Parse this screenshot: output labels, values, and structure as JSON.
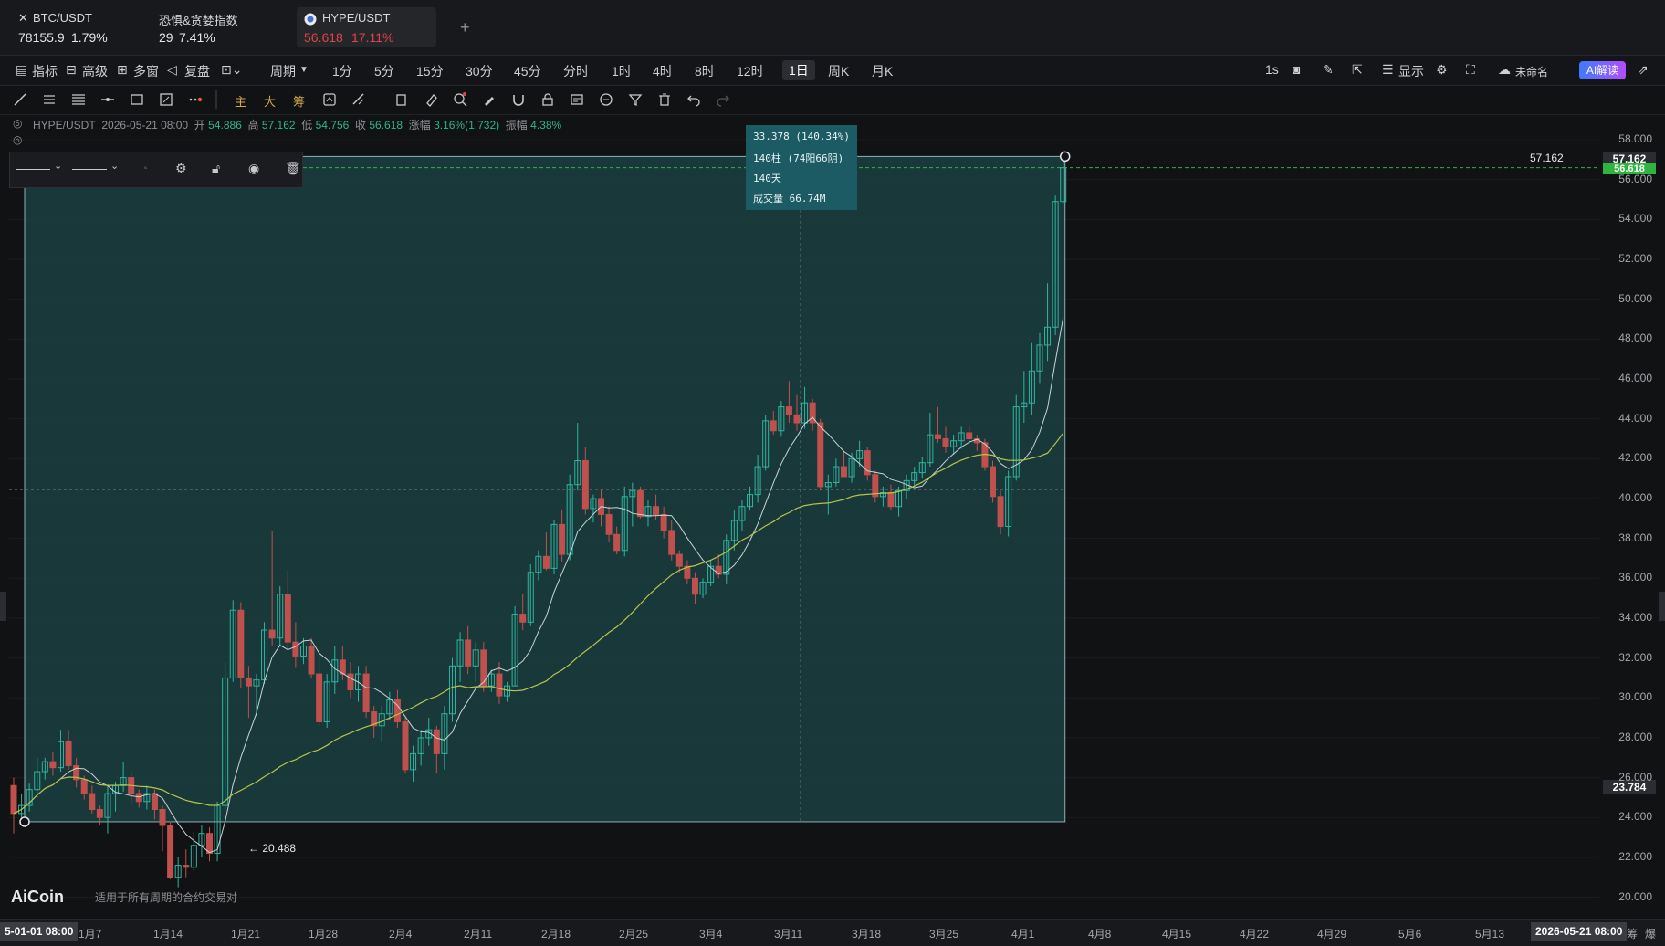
{
  "tabs": [
    {
      "name": "BTC/USDT",
      "price": "78155.9",
      "change": "1.79%",
      "close_icon": "close-icon"
    },
    {
      "name": "恐惧&贪婪指数",
      "price": "29",
      "change": "7.41%"
    },
    {
      "name": "HYPE/USDT",
      "price": "56.618",
      "change": "17.11%",
      "icon": "coin-icon"
    }
  ],
  "add_tab": "+",
  "toolbar": {
    "indicators": "指标",
    "advanced": "高级",
    "multi": "多窗",
    "replay": "复盘",
    "period": "周期",
    "intervals": [
      "1分",
      "5分",
      "15分",
      "30分",
      "45分",
      "分时",
      "1时",
      "4时",
      "8时",
      "12时",
      "1日",
      "周K",
      "月K"
    ],
    "selected_interval": "1日",
    "right": {
      "seconds": "1s",
      "display": "显示",
      "unnamed": "未命名",
      "ai": "AI解读"
    }
  },
  "drawing_tools": {
    "main": "主",
    "big": "大",
    "chip": "筹"
  },
  "info": {
    "symbol": "HYPE/USDT",
    "datetime": "2026-05-21 08:00",
    "open_label": "开",
    "open": "54.886",
    "high_label": "高",
    "high": "57.162",
    "low_label": "低",
    "low": "54.756",
    "close_label": "收",
    "close": "56.618",
    "change_label": "涨幅",
    "change": "3.16%(1.732)",
    "amp_label": "振幅",
    "amp": "4.38%"
  },
  "tooltip": {
    "line1": "33.378 (140.34%)",
    "line2": "140柱 (74阳66阴)",
    "line3": "140天",
    "line4": "成交量 66.74M"
  },
  "price_labels": {
    "high_marker": "57.162",
    "current": "56.618",
    "top_tag": "57.162",
    "low_tag": "23.784",
    "low_marker": "← 20.488"
  },
  "y_axis": [
    "58.000",
    "56.000",
    "54.000",
    "52.000",
    "50.000",
    "48.000",
    "46.000",
    "44.000",
    "42.000",
    "40.000",
    "38.000",
    "36.000",
    "34.000",
    "32.000",
    "30.000",
    "28.000",
    "26.000",
    "24.000",
    "22.000",
    "20.000"
  ],
  "x_axis": {
    "start": "5-01-01 08:00",
    "end": "2026-05-21 08:00",
    "labels": [
      "1月7",
      "1月14",
      "1月21",
      "1月28",
      "2月4",
      "2月11",
      "2月18",
      "2月25",
      "3月4",
      "3月11",
      "3月18",
      "3月25",
      "4月1",
      "4月8",
      "4月15",
      "4月22",
      "4月29",
      "5月6",
      "5月13"
    ],
    "corner": [
      "筹",
      "爆"
    ]
  },
  "logo": "AiCoin",
  "logo_note": "适用于所有周期的合约交易对",
  "colors": {
    "up": "#2eb5a0",
    "down": "#c0504d",
    "ma_fast": "#c9d4d6",
    "ma_slow": "#b8c44a",
    "range_fill": "#1b3f41"
  },
  "chart_data": {
    "type": "candlestick",
    "y_range": [
      19.2,
      58.6
    ],
    "measure_range": {
      "low": 23.784,
      "high": 57.162
    },
    "crosshair_price": 40.45,
    "candles": [
      [
        25.6,
        26.0,
        23.2,
        24.2
      ],
      [
        24.2,
        25.2,
        24.0,
        24.6
      ],
      [
        24.6,
        25.7,
        24.3,
        25.4
      ],
      [
        25.4,
        27.0,
        25.0,
        26.3
      ],
      [
        26.3,
        27.0,
        25.9,
        26.8
      ],
      [
        26.8,
        27.3,
        26.1,
        26.5
      ],
      [
        26.5,
        28.4,
        26.3,
        27.8
      ],
      [
        27.8,
        28.4,
        26.4,
        26.6
      ],
      [
        26.6,
        27.0,
        25.5,
        25.9
      ],
      [
        25.9,
        26.1,
        24.9,
        25.2
      ],
      [
        25.2,
        25.6,
        24.2,
        24.4
      ],
      [
        24.4,
        24.6,
        23.6,
        24.0
      ],
      [
        24.0,
        25.6,
        23.2,
        25.2
      ],
      [
        25.2,
        25.8,
        24.3,
        25.6
      ],
      [
        25.6,
        26.8,
        25.3,
        26.0
      ],
      [
        26.0,
        26.3,
        24.7,
        25.2
      ],
      [
        25.2,
        25.4,
        24.5,
        24.8
      ],
      [
        24.8,
        25.6,
        24.4,
        25.2
      ],
      [
        25.2,
        25.4,
        23.9,
        24.4
      ],
      [
        24.4,
        24.6,
        22.3,
        23.6
      ],
      [
        23.6,
        23.8,
        20.9,
        21.0
      ],
      [
        21.0,
        22.0,
        20.5,
        21.6
      ],
      [
        21.6,
        22.4,
        21.0,
        21.5
      ],
      [
        21.5,
        23.3,
        21.3,
        22.6
      ],
      [
        22.6,
        23.6,
        22.0,
        23.2
      ],
      [
        23.2,
        23.5,
        21.8,
        22.2
      ],
      [
        22.2,
        24.8,
        21.8,
        24.6
      ],
      [
        24.6,
        31.8,
        24.4,
        31.0
      ],
      [
        31.0,
        34.9,
        30.8,
        34.4
      ],
      [
        34.4,
        34.8,
        30.5,
        31.0
      ],
      [
        31.0,
        31.6,
        29.0,
        30.6
      ],
      [
        30.6,
        31.2,
        29.1,
        30.9
      ],
      [
        30.9,
        33.8,
        30.7,
        33.4
      ],
      [
        33.4,
        38.4,
        32.6,
        33.0
      ],
      [
        33.0,
        35.6,
        32.6,
        35.2
      ],
      [
        35.2,
        36.4,
        32.4,
        32.8
      ],
      [
        32.8,
        33.8,
        31.5,
        32.1
      ],
      [
        32.1,
        33.0,
        31.7,
        32.6
      ],
      [
        32.6,
        33.0,
        31.0,
        31.2
      ],
      [
        31.2,
        32.1,
        28.6,
        28.8
      ],
      [
        28.8,
        31.2,
        28.5,
        30.8
      ],
      [
        30.8,
        32.6,
        30.2,
        31.9
      ],
      [
        31.9,
        32.6,
        30.9,
        31.2
      ],
      [
        31.2,
        31.8,
        30.0,
        30.4
      ],
      [
        30.4,
        31.6,
        29.8,
        31.2
      ],
      [
        31.2,
        31.6,
        29.0,
        29.3
      ],
      [
        29.3,
        29.6,
        28.0,
        28.6
      ],
      [
        28.6,
        29.6,
        27.8,
        29.2
      ],
      [
        29.2,
        30.3,
        28.9,
        29.9
      ],
      [
        29.9,
        30.4,
        28.5,
        28.8
      ],
      [
        28.8,
        29.0,
        26.2,
        26.4
      ],
      [
        26.4,
        27.6,
        25.8,
        27.2
      ],
      [
        27.2,
        28.4,
        26.6,
        28.0
      ],
      [
        28.0,
        29.0,
        27.6,
        28.4
      ],
      [
        28.4,
        28.6,
        26.2,
        27.2
      ],
      [
        27.2,
        29.6,
        26.4,
        29.2
      ],
      [
        29.2,
        32.0,
        28.8,
        31.6
      ],
      [
        31.6,
        33.3,
        30.8,
        32.9
      ],
      [
        32.9,
        33.6,
        31.2,
        31.6
      ],
      [
        31.6,
        32.8,
        30.8,
        32.4
      ],
      [
        32.4,
        32.8,
        30.3,
        30.6
      ],
      [
        30.6,
        31.4,
        30.3,
        31.2
      ],
      [
        31.2,
        31.8,
        29.7,
        30.1
      ],
      [
        30.1,
        30.8,
        29.8,
        30.6
      ],
      [
        30.6,
        34.6,
        30.6,
        34.2
      ],
      [
        34.2,
        35.2,
        33.4,
        33.8
      ],
      [
        33.8,
        36.7,
        33.6,
        36.3
      ],
      [
        36.3,
        37.4,
        35.9,
        37.1
      ],
      [
        37.1,
        38.3,
        36.4,
        36.5
      ],
      [
        36.5,
        38.9,
        36.2,
        38.7
      ],
      [
        38.7,
        39.4,
        36.8,
        37.2
      ],
      [
        37.2,
        41.2,
        36.9,
        40.7
      ],
      [
        40.7,
        43.8,
        40.4,
        41.9
      ],
      [
        41.9,
        42.6,
        39.2,
        39.5
      ],
      [
        39.5,
        40.2,
        38.8,
        40.0
      ],
      [
        40.0,
        40.5,
        38.6,
        39.2
      ],
      [
        39.2,
        39.6,
        37.8,
        38.2
      ],
      [
        38.2,
        38.6,
        37.2,
        37.4
      ],
      [
        37.4,
        40.6,
        37.1,
        40.1
      ],
      [
        40.1,
        40.8,
        38.6,
        40.4
      ],
      [
        40.4,
        40.6,
        39.0,
        39.1
      ],
      [
        39.1,
        39.9,
        38.6,
        39.6
      ],
      [
        39.6,
        40.2,
        38.9,
        39.2
      ],
      [
        39.2,
        39.6,
        38.0,
        38.4
      ],
      [
        38.4,
        38.9,
        36.9,
        37.2
      ],
      [
        37.2,
        37.4,
        36.3,
        36.6
      ],
      [
        36.6,
        36.9,
        35.7,
        36.0
      ],
      [
        36.0,
        36.3,
        34.7,
        35.2
      ],
      [
        35.2,
        36.0,
        35.0,
        35.8
      ],
      [
        35.8,
        36.9,
        35.6,
        36.6
      ],
      [
        36.6,
        37.2,
        36.0,
        36.2
      ],
      [
        36.2,
        38.2,
        35.7,
        37.9
      ],
      [
        37.9,
        39.4,
        37.4,
        38.9
      ],
      [
        38.9,
        39.9,
        38.4,
        39.6
      ],
      [
        39.6,
        40.6,
        39.4,
        40.2
      ],
      [
        40.2,
        42.2,
        39.8,
        41.6
      ],
      [
        41.6,
        44.2,
        41.4,
        43.9
      ],
      [
        43.9,
        44.4,
        43.2,
        43.4
      ],
      [
        43.4,
        44.9,
        43.1,
        44.6
      ],
      [
        44.6,
        45.9,
        43.8,
        44.2
      ],
      [
        44.2,
        45.2,
        43.4,
        43.8
      ],
      [
        43.8,
        45.6,
        43.5,
        44.8
      ],
      [
        44.8,
        45.0,
        43.4,
        43.8
      ],
      [
        43.8,
        44.0,
        40.4,
        40.6
      ],
      [
        40.6,
        41.2,
        39.2,
        40.8
      ],
      [
        40.8,
        42.0,
        40.6,
        41.6
      ],
      [
        41.6,
        42.4,
        41.3,
        41.1
      ],
      [
        41.1,
        42.3,
        40.8,
        42.0
      ],
      [
        42.0,
        42.9,
        41.6,
        42.4
      ],
      [
        42.4,
        42.6,
        40.9,
        41.2
      ],
      [
        41.2,
        41.4,
        39.8,
        40.1
      ],
      [
        40.1,
        40.6,
        39.6,
        40.3
      ],
      [
        40.3,
        40.7,
        39.4,
        39.6
      ],
      [
        39.6,
        40.6,
        39.1,
        40.4
      ],
      [
        40.4,
        41.2,
        40.0,
        40.9
      ],
      [
        40.9,
        41.6,
        40.6,
        41.3
      ],
      [
        41.3,
        42.1,
        41.0,
        41.8
      ],
      [
        41.8,
        44.3,
        41.6,
        43.2
      ],
      [
        43.2,
        44.6,
        42.8,
        43.0
      ],
      [
        43.0,
        43.6,
        42.3,
        42.6
      ],
      [
        42.6,
        43.2,
        42.2,
        42.9
      ],
      [
        42.9,
        43.6,
        42.5,
        43.3
      ],
      [
        43.3,
        43.7,
        42.8,
        43.0
      ],
      [
        43.0,
        43.2,
        42.4,
        42.8
      ],
      [
        42.8,
        43.0,
        41.4,
        41.6
      ],
      [
        41.6,
        41.9,
        39.8,
        40.1
      ],
      [
        40.1,
        40.4,
        38.2,
        38.6
      ],
      [
        38.6,
        41.4,
        38.1,
        41.1
      ],
      [
        41.1,
        45.2,
        40.9,
        44.6
      ],
      [
        44.6,
        46.4,
        43.8,
        44.8
      ],
      [
        44.8,
        47.8,
        44.2,
        46.4
      ],
      [
        46.4,
        48.3,
        45.8,
        47.7
      ],
      [
        47.7,
        50.8,
        46.9,
        48.6
      ],
      [
        48.6,
        55.2,
        48.2,
        54.9
      ],
      [
        54.9,
        57.2,
        54.8,
        56.6
      ]
    ]
  }
}
